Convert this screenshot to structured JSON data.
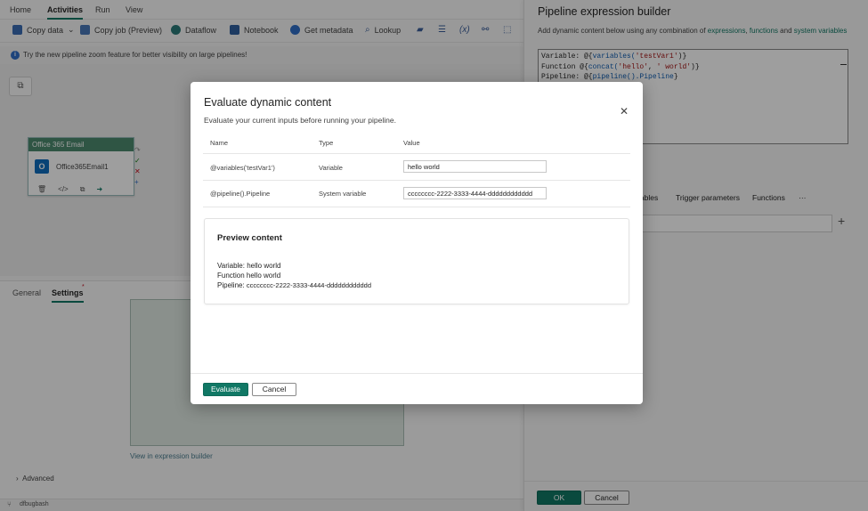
{
  "menubar": {
    "items": [
      "Home",
      "Activities",
      "Run",
      "View"
    ],
    "active": "Activities"
  },
  "toolbar": {
    "copy_data": "Copy data",
    "copy_job": "Copy job (Preview)",
    "dataflow": "Dataflow",
    "notebook": "Notebook",
    "get_metadata": "Get metadata",
    "lookup": "Lookup"
  },
  "infobar": {
    "text": "Try the new pipeline zoom feature for better visibility on large pipelines!"
  },
  "activity": {
    "header": "Office 365 Email",
    "name": "Office365Email1"
  },
  "lower_tabs": {
    "general": "General",
    "settings": "Settings",
    "badge": "*"
  },
  "lower": {
    "view_link": "View in expression builder",
    "advanced": "Advanced"
  },
  "status": {
    "branch": "dfbugbash"
  },
  "right_panel": {
    "title": "Pipeline expression builder",
    "desc_prefix": "Add dynamic content below using any combination of ",
    "link_expressions": "expressions",
    "link_functions": "functions",
    "desc_and": " and ",
    "link_sysvars": "system variables",
    "code": {
      "line1_prefix": "Variable: @{",
      "line1_fn": "variables(",
      "line1_str": "'testVar1'",
      "line1_suffix": ")}",
      "line2_prefix": "Function @{",
      "line2_fn": "concat(",
      "line2_str1": "'hello'",
      "line2_mid": ", ",
      "line2_str2": "' world'",
      "line2_suffix": ")}",
      "line3_prefix": "Pipeline: @{",
      "line3_fn": "pipeline().Pipeline",
      "line3_suffix": "}"
    },
    "tabs": [
      "iables",
      "Trigger parameters",
      "Functions",
      "···"
    ],
    "ok": "OK",
    "cancel": "Cancel"
  },
  "dialog": {
    "title": "Evaluate dynamic content",
    "subtitle": "Evaluate your current inputs before running your pipeline.",
    "columns": {
      "name": "Name",
      "type": "Type",
      "value": "Value"
    },
    "rows": [
      {
        "name": "@variables('testVar1')",
        "type": "Variable",
        "value": "hello world"
      },
      {
        "name": "@pipeline().Pipeline",
        "type": "System variable",
        "value": "cccccccc-2222-3333-4444-dddddddddddd"
      }
    ],
    "preview": {
      "title": "Preview content",
      "line1": "Variable: hello world",
      "line2": "Function hello world",
      "line3_label": "Pipeline:",
      "line3_value": "cccccccc-2222-3333-4444-dddddddddddd"
    },
    "evaluate": "Evaluate",
    "cancel": "Cancel"
  }
}
